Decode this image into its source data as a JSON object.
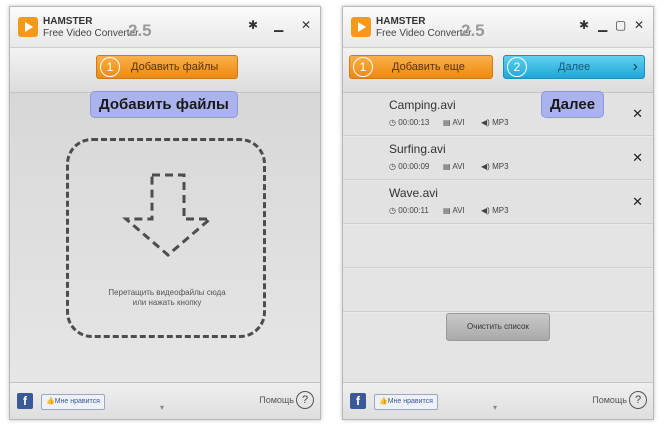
{
  "app": {
    "brand": "HAMSTER",
    "subtitle": "Free Video Converter",
    "version": "2.5"
  },
  "left": {
    "step_number": "1",
    "add_button_label": "Добавить файлы",
    "callout": "Добавить файлы",
    "drop_text_line1": "Перетащить видеофайлы сюда",
    "drop_text_line2": "или нажать кнопку",
    "like_label": "Мне нравится",
    "help_label": "Помощь"
  },
  "right": {
    "step1_number": "1",
    "add_more_label": "Добавить еще",
    "step2_number": "2",
    "next_label": "Далее",
    "callout": "Далее",
    "files": [
      {
        "name": "Camping.avi",
        "duration": "00:00:13",
        "video": "AVI",
        "audio": "MP3"
      },
      {
        "name": "Surfing.avi",
        "duration": "00:00:09",
        "video": "AVI",
        "audio": "MP3"
      },
      {
        "name": "Wave.avi",
        "duration": "00:00:11",
        "video": "AVI",
        "audio": "MP3"
      }
    ],
    "clear_label": "Очистить список",
    "like_label": "Мне нравится",
    "help_label": "Помощь"
  },
  "icons": {
    "settings": "gear-icon",
    "minimize": "minimize-icon",
    "maximize": "maximize-icon",
    "close": "close-icon",
    "remove": "remove-icon",
    "clock": "clock-icon",
    "film": "film-icon",
    "speaker": "speaker-icon",
    "help": "help-icon",
    "arrow": "chevron-right-icon",
    "facebook": "facebook-icon"
  },
  "colors": {
    "orange": "#ee8a10",
    "blue": "#21a6d8",
    "callout": "#aab3ee",
    "facebook": "#3b5998"
  }
}
